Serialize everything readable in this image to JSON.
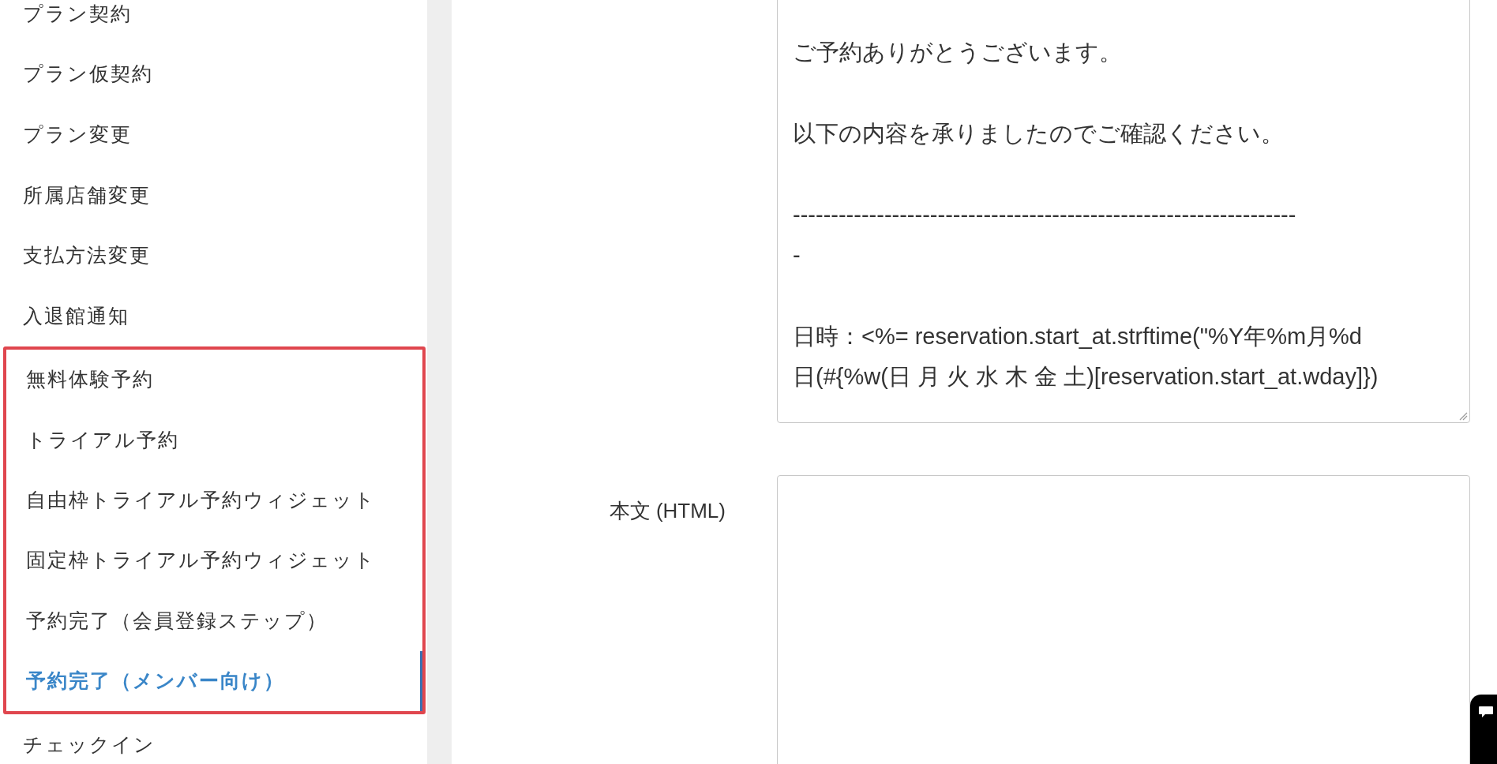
{
  "sidebar": {
    "groups": [
      {
        "kind": "plain",
        "items": [
          {
            "label": "プラン契約",
            "selected": false
          },
          {
            "label": "プラン仮契約",
            "selected": false
          },
          {
            "label": "プラン変更",
            "selected": false
          },
          {
            "label": "所属店舗変更",
            "selected": false
          },
          {
            "label": "支払方法変更",
            "selected": false
          },
          {
            "label": "入退館通知",
            "selected": false
          }
        ]
      },
      {
        "kind": "highlighted",
        "items": [
          {
            "label": "無料体験予約",
            "selected": false
          },
          {
            "label": "トライアル予約",
            "selected": false
          },
          {
            "label": "自由枠トライアル予約ウィジェット",
            "selected": false
          },
          {
            "label": "固定枠トライアル予約ウィジェット",
            "selected": false
          },
          {
            "label": "予約完了（会員登録ステップ）",
            "selected": false
          },
          {
            "label": "予約完了（メンバー向け）",
            "selected": true
          }
        ]
      },
      {
        "kind": "plain",
        "items": [
          {
            "label": "チェックイン",
            "selected": false
          }
        ]
      }
    ]
  },
  "form": {
    "fields": [
      {
        "paragraphs": [
          [
            "ご予約ありがとうございます。"
          ],
          [
            "以下の内容を承りましたのでご確認ください。"
          ],
          [
            "------------------------------------------------------------------",
            "-"
          ],
          [
            "日時：<%= reservation.start_at.strftime(\"%Y年%m月%d",
            "日(#{%w(日 月 火 水 木 金 土)[reservation.start_at.wday]})"
          ]
        ]
      },
      {
        "label_text": "本文 (HTML)"
      }
    ]
  }
}
